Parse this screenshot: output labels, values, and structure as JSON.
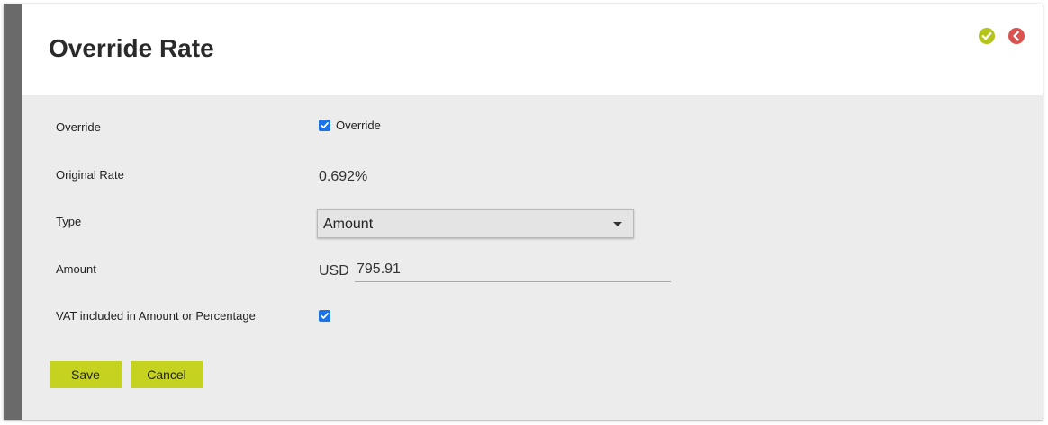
{
  "header": {
    "title": "Override Rate",
    "confirm_icon": "check-circle-icon",
    "back_icon": "chevron-left-circle-icon",
    "confirm_color": "#b5c41a",
    "back_color": "#d9534f"
  },
  "form": {
    "override": {
      "label": "Override",
      "checkbox_label": "Override",
      "checked": true
    },
    "original_rate": {
      "label": "Original Rate",
      "value": "0.692%"
    },
    "type": {
      "label": "Type",
      "selected": "Amount"
    },
    "amount": {
      "label": "Amount",
      "currency": "USD",
      "value": "795.91"
    },
    "vat": {
      "label": "VAT included in Amount or Percentage",
      "checked": true
    }
  },
  "actions": {
    "save_label": "Save",
    "cancel_label": "Cancel",
    "button_color": "#c5d21f"
  },
  "colors": {
    "checkbox": "#1a73e8",
    "side_bar": "#6a6a6a",
    "panel_bg": "#ececec"
  }
}
